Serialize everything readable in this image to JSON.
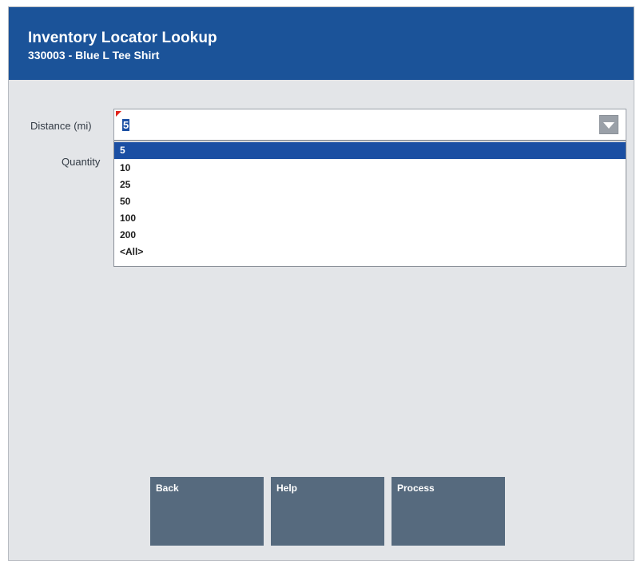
{
  "header": {
    "title": "Inventory Locator Lookup",
    "subtitle": "330003 - Blue L Tee Shirt"
  },
  "form": {
    "distance_label": "Distance (mi)",
    "quantity_label": "Quantity",
    "distance_value": "5"
  },
  "dropdown": {
    "selected_index": 0,
    "options": [
      "5",
      "10",
      "25",
      "50",
      "100",
      "200",
      "<All>"
    ]
  },
  "buttons": {
    "back": "Back",
    "help": "Help",
    "process": "Process"
  },
  "colors": {
    "header_bg": "#1b5399",
    "selection": "#1b4fa3",
    "button_bg": "#566a7e",
    "required_flag": "#e0231b"
  },
  "icons": {
    "dropdown_arrow": "chevron-down-icon",
    "required_marker": "required-flag-icon"
  }
}
